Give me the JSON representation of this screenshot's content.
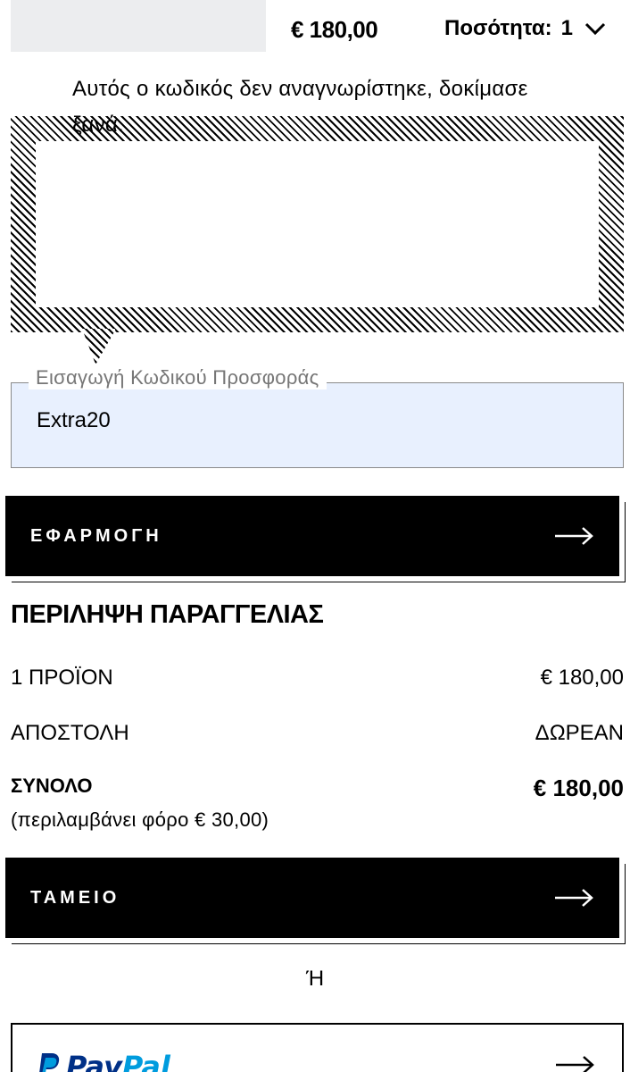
{
  "cart_item": {
    "price": "€ 180,00",
    "quantity_label": "Ποσότητα:",
    "quantity_value": "1"
  },
  "promo": {
    "error_message": "Αυτός ο κωδικός δεν αναγνωρίστηκε, δοκίμασε ξανά.",
    "field_label": "Εισαγωγή Κωδικού Προσφοράς",
    "field_value": "Extra20",
    "apply_button": "ΕΦΑΡΜΟΓΗ"
  },
  "summary": {
    "title": "ΠΕΡΙΛΗΨΗ ΠΑΡΑΓΓΕΛΙΑΣ",
    "items_label": "1 ΠΡΟΪΟΝ",
    "items_value": "€ 180,00",
    "shipping_label": "ΑΠΟΣΤΟΛΗ",
    "shipping_value": "ΔΩΡΕΑΝ",
    "total_label": "ΣΥΝΟΛΟ",
    "total_value": "€ 180,00",
    "tax_note": "(περιλαμβάνει φόρο  € 30,00)"
  },
  "checkout": {
    "button_label": "ΤΑΜΕΙΟ",
    "or_text": "Ή",
    "paypal_pay": "Pay",
    "paypal_pal": "Pal"
  },
  "icons": {
    "quantity_chevron": "chevron-down-icon",
    "apply_arrow": "arrow-right-icon",
    "checkout_arrow": "arrow-right-icon",
    "paypal_logo": "paypal-logo-icon",
    "paypal_arrow": "arrow-right-icon"
  },
  "colors": {
    "button_bg": "#000000",
    "promo_field_bg": "#e8f0fe",
    "paypal_dark_blue": "#003087",
    "paypal_light_blue": "#009cde"
  }
}
